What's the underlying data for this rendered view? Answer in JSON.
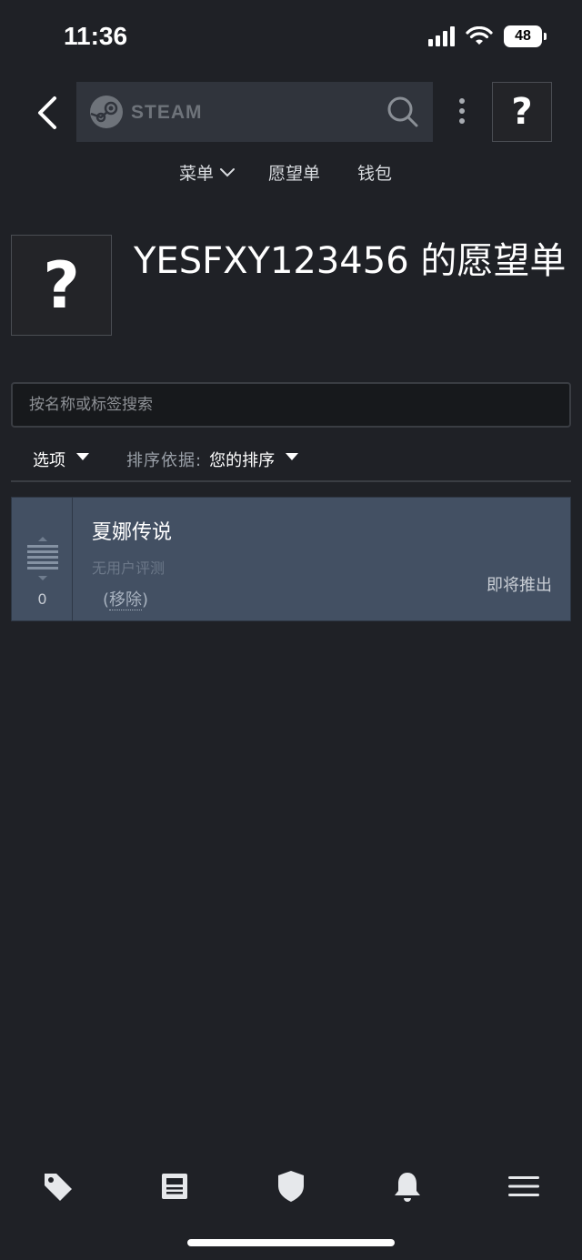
{
  "status_bar": {
    "time": "11:36",
    "battery": "48"
  },
  "header": {
    "logo_text": "STEAM",
    "avatar_glyph": "?"
  },
  "nav": {
    "menu_label": "菜单",
    "wishlist_label": "愿望单",
    "wallet_label": "钱包"
  },
  "profile": {
    "avatar_glyph": "?",
    "title": "YESFXY123456 的愿望单"
  },
  "wishlist_search": {
    "placeholder": "按名称或标签搜索"
  },
  "options": {
    "options_label": "选项",
    "sort_prefix": "排序依据:",
    "sort_value": "您的排序"
  },
  "items": [
    {
      "rank": "0",
      "title": "夏娜传说",
      "review": "无用户评测",
      "remove_open": "(",
      "remove_label": "移除",
      "remove_close": ")",
      "release": "即将推出"
    }
  ],
  "tabbar": {
    "icons": [
      "tag-icon",
      "news-icon",
      "shield-icon",
      "bell-icon",
      "menu-icon"
    ]
  },
  "colors": {
    "background": "#1f2126",
    "search_bar": "#30343c",
    "item_background": "#435063",
    "accent_text": "#ffffff"
  }
}
